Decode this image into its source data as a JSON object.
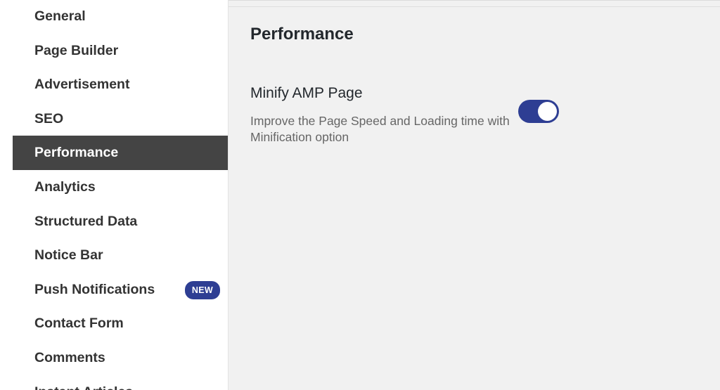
{
  "sidebar": {
    "items": [
      {
        "label": "General"
      },
      {
        "label": "Page Builder"
      },
      {
        "label": "Advertisement"
      },
      {
        "label": "SEO"
      },
      {
        "label": "Performance"
      },
      {
        "label": "Analytics"
      },
      {
        "label": "Structured Data"
      },
      {
        "label": "Notice Bar"
      },
      {
        "label": "Push Notifications",
        "badge": "NEW"
      },
      {
        "label": "Contact Form"
      },
      {
        "label": "Comments"
      },
      {
        "label": "Instant Articles"
      }
    ],
    "active_item": "Performance"
  },
  "main": {
    "title": "Performance",
    "setting": {
      "title": "Minify AMP Page",
      "description": "Improve the Page Speed and Loading time with Minification option",
      "enabled": true
    }
  },
  "colors": {
    "accent": "#2e3e93",
    "active_bg": "#444444",
    "content_bg": "#f1f1f1"
  }
}
